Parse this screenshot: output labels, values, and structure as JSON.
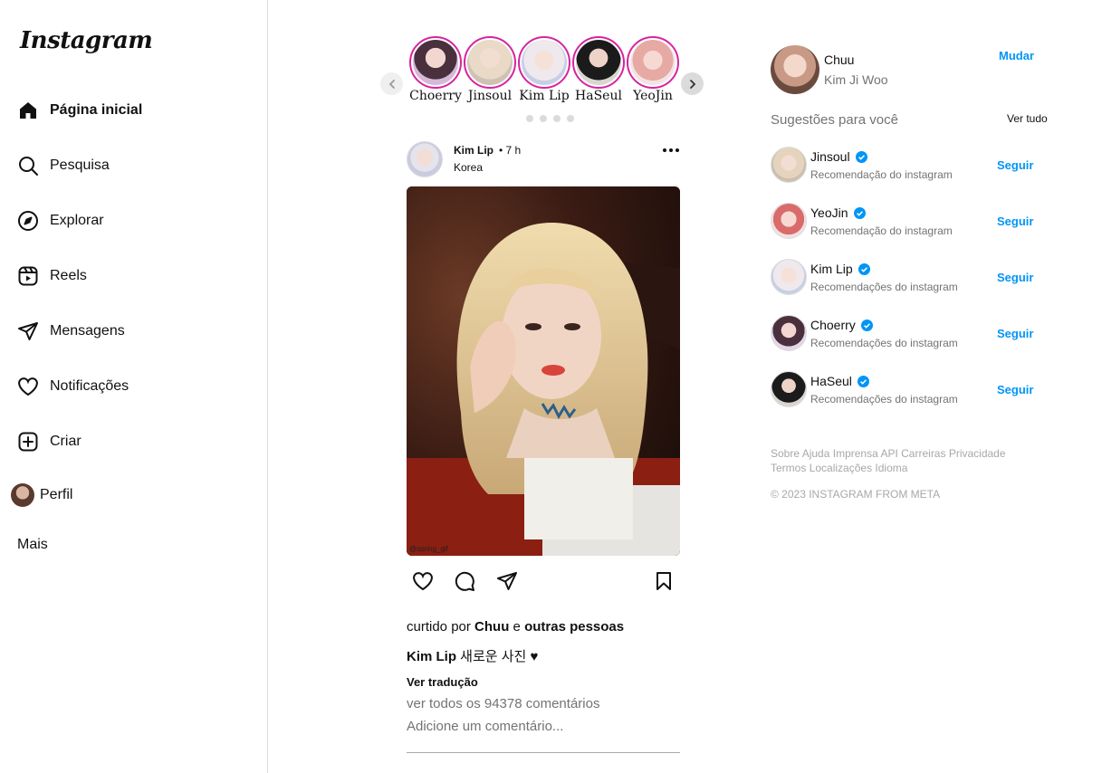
{
  "app": {
    "logo": "Instagram"
  },
  "sidebar": {
    "items": [
      {
        "label": "Página inicial",
        "icon": "home-icon"
      },
      {
        "label": "Pesquisa",
        "icon": "search-icon"
      },
      {
        "label": "Explorar",
        "icon": "compass-icon"
      },
      {
        "label": "Reels",
        "icon": "reels-icon"
      },
      {
        "label": "Mensagens",
        "icon": "send-icon"
      },
      {
        "label": "Notificações",
        "icon": "heart-icon"
      },
      {
        "label": "Criar",
        "icon": "plus-square-icon"
      },
      {
        "label": "Perfil",
        "icon": "avatar"
      }
    ],
    "more": "Mais"
  },
  "stories": [
    {
      "name": "Choerry"
    },
    {
      "name": "Jinsoul"
    },
    {
      "name": "Kim Lip"
    },
    {
      "name": "HaSeul"
    },
    {
      "name": "YeoJin"
    }
  ],
  "post": {
    "user": "Kim Lip",
    "time": "• 7 h",
    "location": "Korea",
    "watermark": "@spring_gif",
    "liked_prefix": "curtido por",
    "liked_user": "Chuu",
    "liked_and": "e",
    "liked_others": "outras pessoas",
    "caption_user": "Kim Lip",
    "caption_text": "새로운 사진 ♥",
    "translate": "Ver tradução",
    "view_comments": "ver todos os 94378 comentários",
    "comment_placeholder": "Adicione um comentário..."
  },
  "me": {
    "username": "Chuu",
    "name": "Kim Ji Woo",
    "switch": "Mudar"
  },
  "suggestions": {
    "title": "Sugestões para você",
    "see_all": "Ver tudo",
    "follow_label": "Seguir",
    "items": [
      {
        "name": "Jinsoul",
        "sub": "Recomendação do instagram"
      },
      {
        "name": "YeoJin",
        "sub": "Recomendação do instagram"
      },
      {
        "name": "Kim Lip",
        "sub": "Recomendações do instagram"
      },
      {
        "name": "Choerry",
        "sub": "Recomendações do instagram"
      },
      {
        "name": "HaSeul",
        "sub": "Recomendações do instagram"
      }
    ]
  },
  "footer": {
    "links": [
      "Sobre",
      "Ajuda",
      "Imprensa",
      "API",
      "Carreiras",
      "Privacidade",
      "Termos",
      "Localizações",
      "Idioma"
    ],
    "copyright": "© 2023 INSTAGRAM FROM META"
  },
  "colors": {
    "link": "#0095f6",
    "story_ring": "#d6249f",
    "muted": "#737373"
  }
}
